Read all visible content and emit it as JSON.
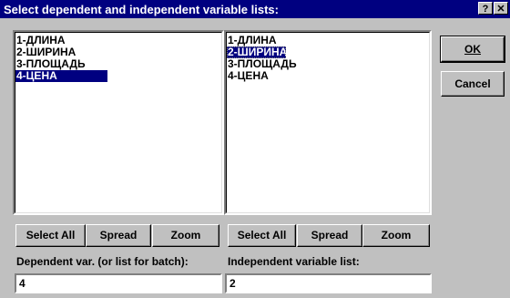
{
  "dialog": {
    "title": "Select dependent and independent variable lists:",
    "help_button": "?",
    "close_button": "✕"
  },
  "dependent_list": {
    "items": [
      "1-ДЛИНА",
      "2-ШИРИНА",
      "3-ПЛОЩАДЬ",
      "4-ЦЕНА"
    ],
    "selected_index": 3
  },
  "independent_list": {
    "items": [
      "1-ДЛИНА",
      "2-ШИРИНА",
      "3-ПЛОЩАДЬ",
      "4-ЦЕНА"
    ],
    "selected_index": 1
  },
  "dependent_buttons": {
    "select_all": "Select All",
    "spread": "Spread",
    "zoom": "Zoom"
  },
  "independent_buttons": {
    "select_all": "Select All",
    "spread": "Spread",
    "zoom": "Zoom"
  },
  "dependent_field": {
    "label": "Dependent var. (or list for batch):",
    "value": "4"
  },
  "independent_field": {
    "label": "Independent variable list:",
    "value": "2"
  },
  "actions": {
    "ok": "OK",
    "cancel": "Cancel"
  }
}
